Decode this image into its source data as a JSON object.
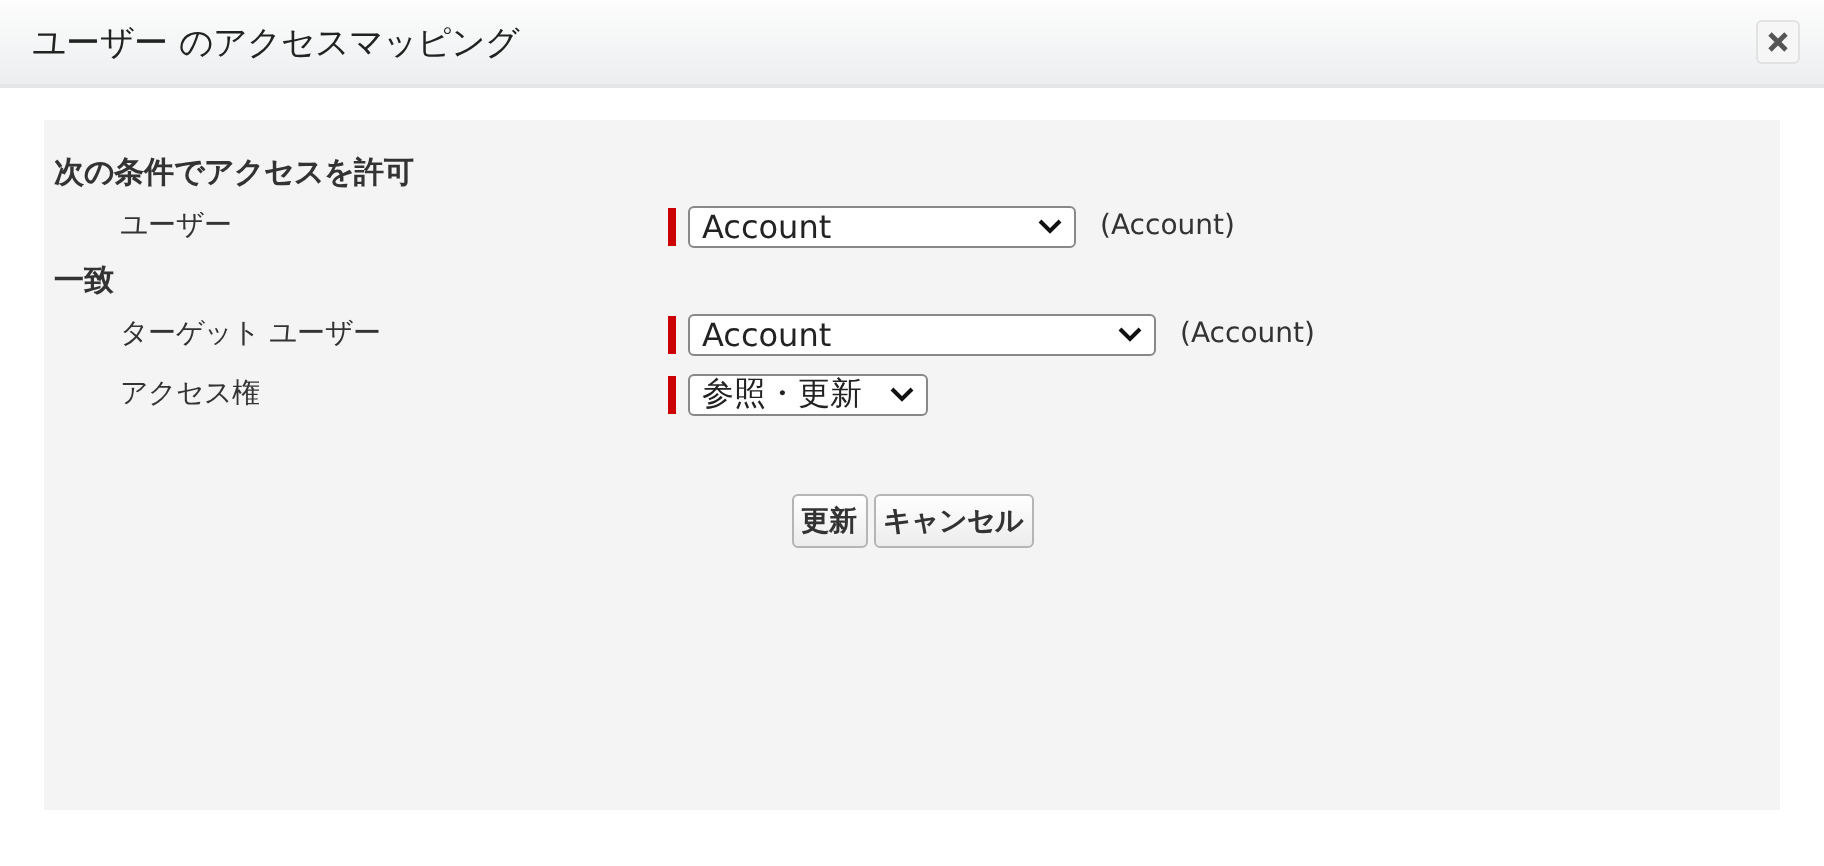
{
  "dialog": {
    "title": "ユーザー のアクセスマッピング"
  },
  "sections": [
    {
      "heading": "次の条件でアクセスを許可",
      "fields": [
        {
          "label": "ユーザー",
          "required": true,
          "value": "Account",
          "note": "(Account)"
        }
      ]
    },
    {
      "heading": "一致",
      "fields": [
        {
          "label": "ターゲット ユーザー",
          "required": true,
          "value": "Account",
          "note": "(Account)"
        },
        {
          "label": "アクセス権",
          "required": true,
          "value": "参照・更新"
        }
      ]
    }
  ],
  "buttons": [
    "更新",
    "キャンセル"
  ]
}
